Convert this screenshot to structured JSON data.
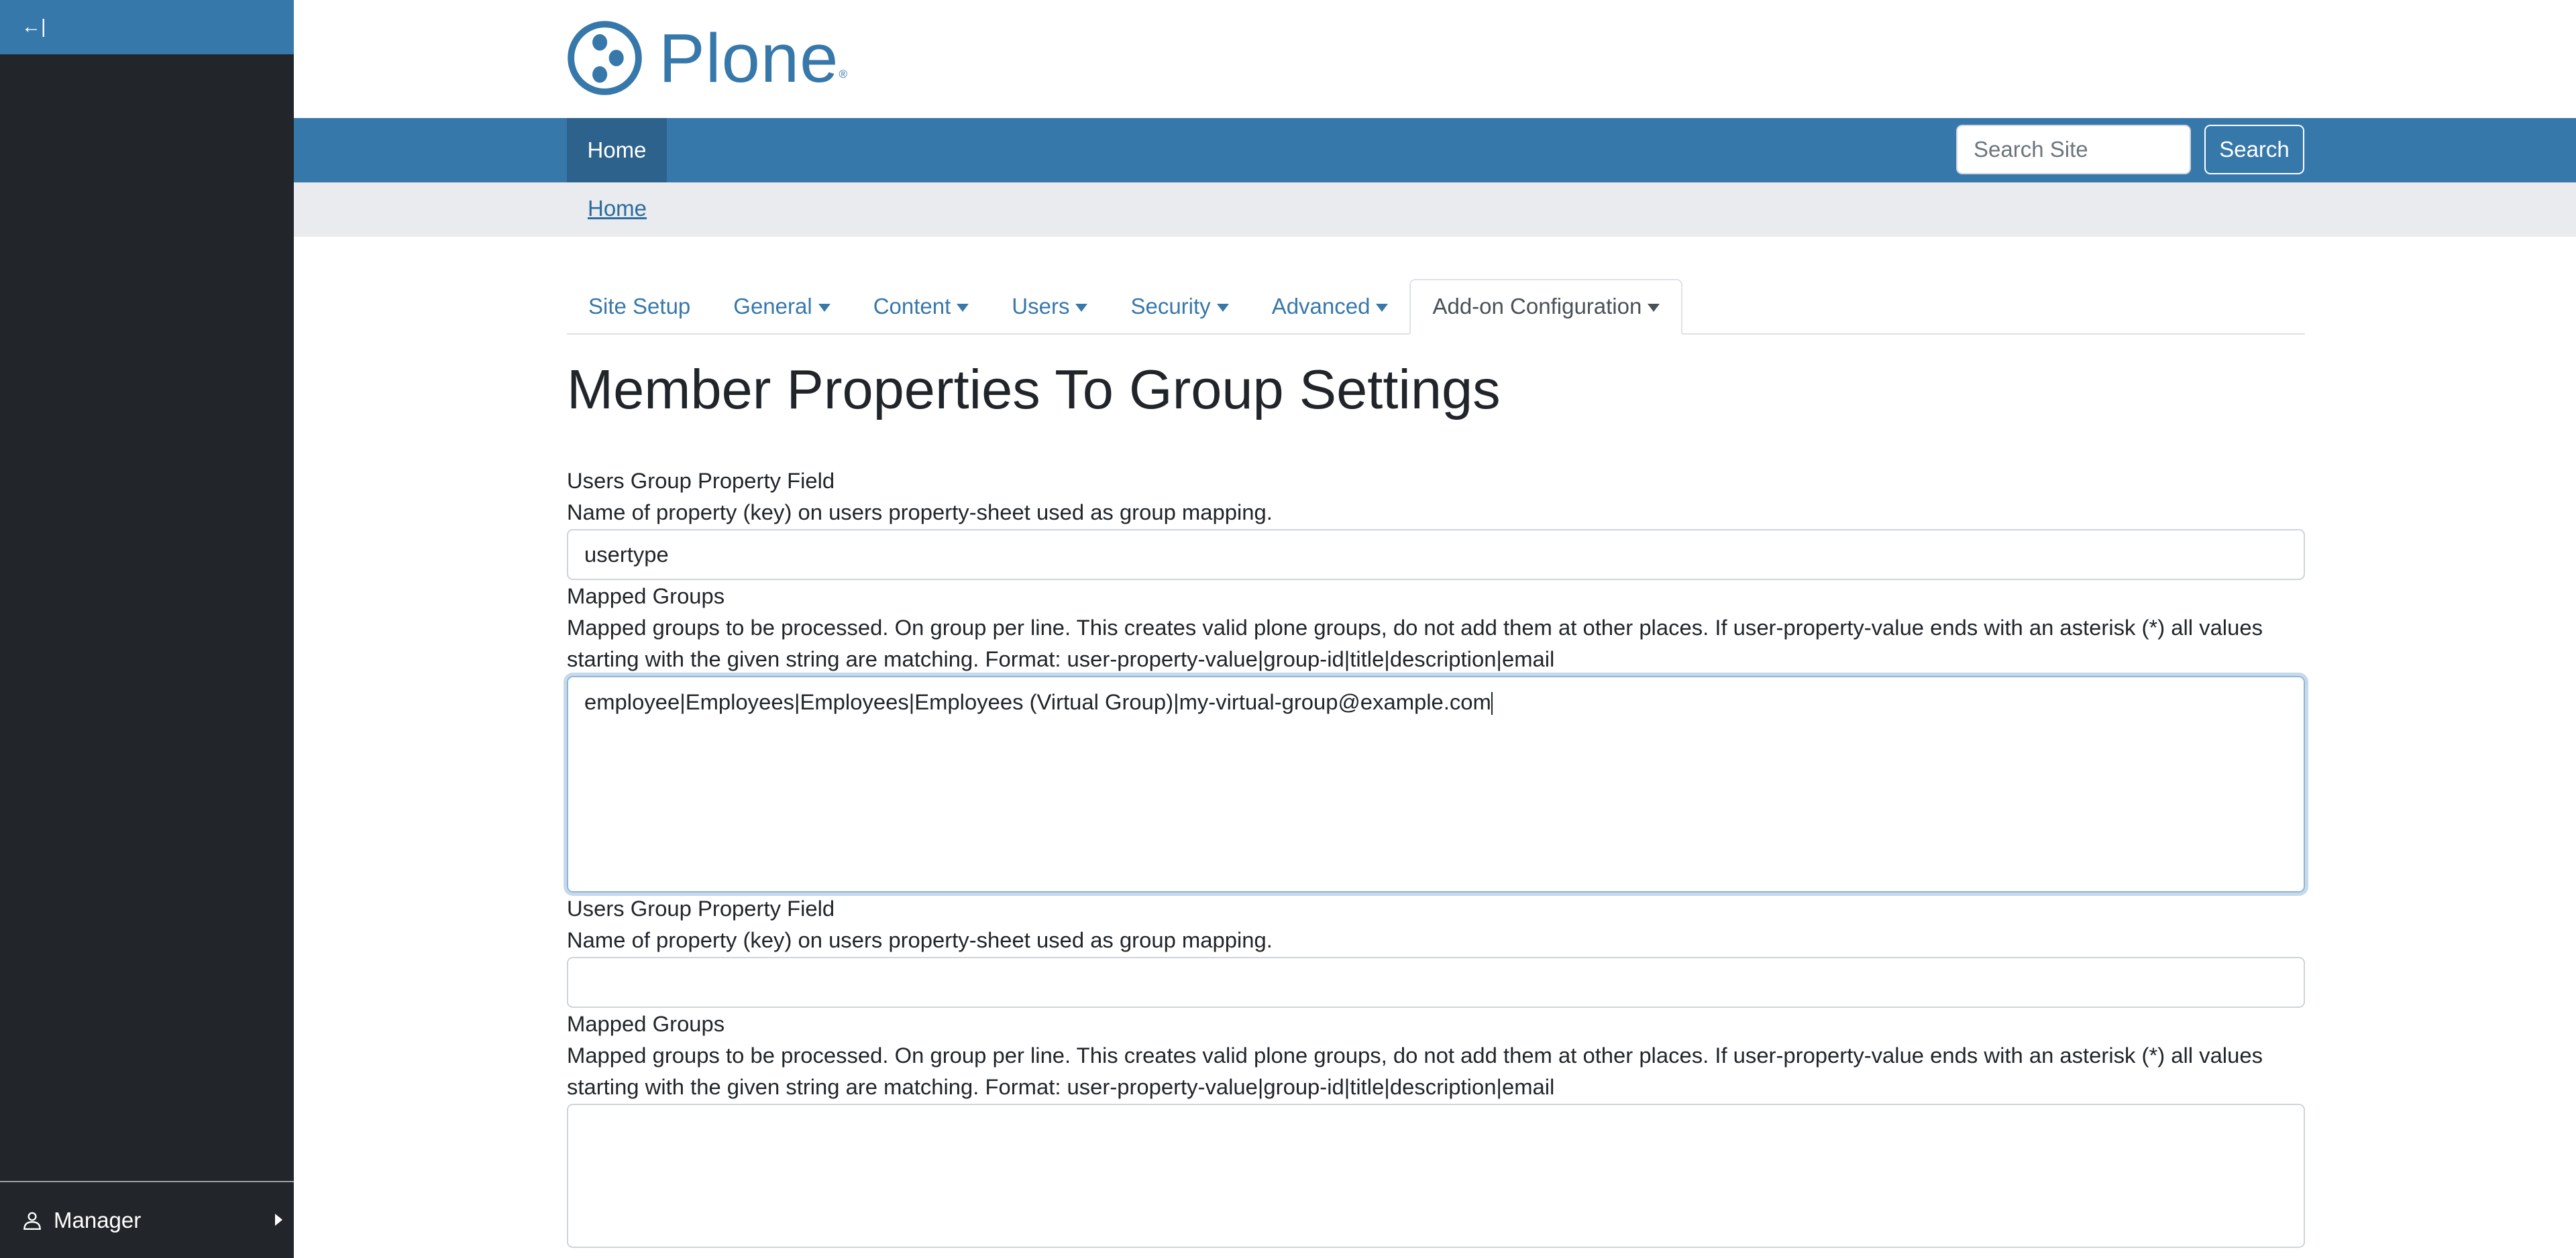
{
  "sidebar": {
    "collapse_label": "←|",
    "user_label": "Manager"
  },
  "header": {
    "logo_text": "Plone",
    "logo_mark": "®"
  },
  "nav": {
    "home": "Home",
    "search_placeholder": "Search Site",
    "search_button": "Search"
  },
  "breadcrumb": {
    "home": "Home"
  },
  "tabs": [
    {
      "label": "Site Setup"
    },
    {
      "label": "General"
    },
    {
      "label": "Content"
    },
    {
      "label": "Users"
    },
    {
      "label": "Security"
    },
    {
      "label": "Advanced"
    },
    {
      "label": "Add-on Configuration"
    }
  ],
  "page_title": "Member Properties To Group Settings",
  "fields": [
    {
      "property_label": "Users Group Property Field",
      "property_desc": "Name of property (key) on users property-sheet used as group mapping.",
      "property_value": "usertype",
      "groups_label": "Mapped Groups",
      "groups_desc": "Mapped groups to be processed. On group per line. This creates valid plone groups, do not add them at other places. If user-property-value ends with an asterisk (*) all values starting with the given string are matching. Format: user-property-value|group-id|title|description|email",
      "groups_value": "employee|Employees|Employees|Employees (Virtual Group)|my-virtual-group@example.com"
    },
    {
      "property_label": "Users Group Property Field",
      "property_desc": "Name of property (key) on users property-sheet used as group mapping.",
      "property_value": "",
      "groups_label": "Mapped Groups",
      "groups_desc": "Mapped groups to be processed. On group per line. This creates valid plone groups, do not add them at other places. If user-property-value ends with an asterisk (*) all values starting with the given string are matching. Format: user-property-value|group-id|title|description|email",
      "groups_value": ""
    }
  ]
}
